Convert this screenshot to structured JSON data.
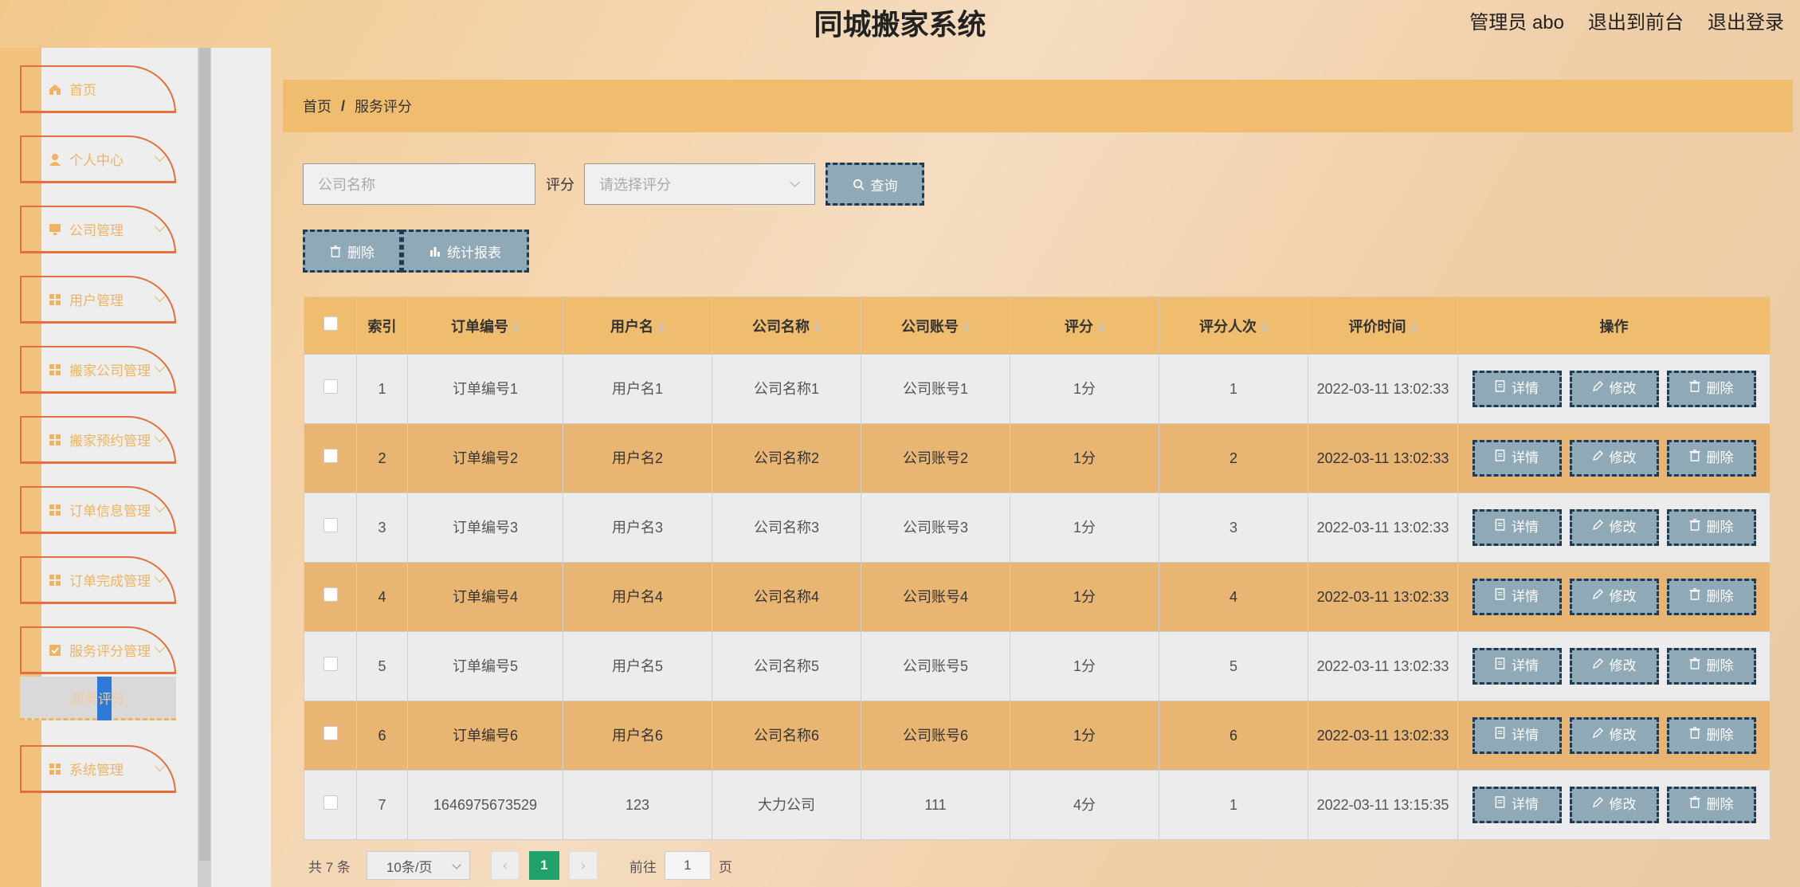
{
  "header": {
    "title": "同城搬家系统",
    "admin": "管理员 abo",
    "back_front": "退出到前台",
    "logout": "退出登录"
  },
  "sidebar": {
    "items": [
      {
        "label": "首页",
        "icon": "home-icon",
        "has_children": false
      },
      {
        "label": "个人中心",
        "icon": "user-icon",
        "has_children": true
      },
      {
        "label": "公司管理",
        "icon": "monitor-icon",
        "has_children": true
      },
      {
        "label": "用户管理",
        "icon": "grid-icon",
        "has_children": true
      },
      {
        "label": "搬家公司管理",
        "icon": "grid-icon",
        "has_children": true
      },
      {
        "label": "搬家预约管理",
        "icon": "grid-icon",
        "has_children": true
      },
      {
        "label": "订单信息管理",
        "icon": "grid-icon",
        "has_children": true
      },
      {
        "label": "订单完成管理",
        "icon": "grid-icon",
        "has_children": true
      },
      {
        "label": "服务评分管理",
        "icon": "checkbox-icon",
        "has_children": true
      },
      {
        "label": "系统管理",
        "icon": "grid-icon",
        "has_children": true
      }
    ],
    "active_sub": "服务评分"
  },
  "breadcrumb": {
    "home": "首页",
    "sep": "/",
    "current": "服务评分"
  },
  "search": {
    "company_placeholder": "公司名称",
    "rating_label": "评分",
    "rating_placeholder": "请选择评分",
    "query_label": "查询"
  },
  "actions": {
    "delete_label": "删除",
    "stats_label": "统计报表"
  },
  "table": {
    "headers": [
      "索引",
      "订单编号",
      "用户名",
      "公司名称",
      "公司账号",
      "评分",
      "评分人次",
      "评价时间",
      "操作"
    ],
    "rows": [
      {
        "index": "1",
        "order": "订单编号1",
        "user": "用户名1",
        "company": "公司名称1",
        "account": "公司账号1",
        "rating": "1分",
        "count": "1",
        "time": "2022-03-11 13:02:33"
      },
      {
        "index": "2",
        "order": "订单编号2",
        "user": "用户名2",
        "company": "公司名称2",
        "account": "公司账号2",
        "rating": "1分",
        "count": "2",
        "time": "2022-03-11 13:02:33"
      },
      {
        "index": "3",
        "order": "订单编号3",
        "user": "用户名3",
        "company": "公司名称3",
        "account": "公司账号3",
        "rating": "1分",
        "count": "3",
        "time": "2022-03-11 13:02:33"
      },
      {
        "index": "4",
        "order": "订单编号4",
        "user": "用户名4",
        "company": "公司名称4",
        "account": "公司账号4",
        "rating": "1分",
        "count": "4",
        "time": "2022-03-11 13:02:33"
      },
      {
        "index": "5",
        "order": "订单编号5",
        "user": "用户名5",
        "company": "公司名称5",
        "account": "公司账号5",
        "rating": "1分",
        "count": "5",
        "time": "2022-03-11 13:02:33"
      },
      {
        "index": "6",
        "order": "订单编号6",
        "user": "用户名6",
        "company": "公司名称6",
        "account": "公司账号6",
        "rating": "1分",
        "count": "6",
        "time": "2022-03-11 13:02:33"
      },
      {
        "index": "7",
        "order": "1646975673529",
        "user": "123",
        "company": "大力公司",
        "account": "111",
        "rating": "4分",
        "count": "1",
        "time": "2022-03-11 13:15:35"
      }
    ],
    "op_labels": {
      "detail": "详情",
      "edit": "修改",
      "delete": "删除"
    }
  },
  "pagination": {
    "total": "共 7 条",
    "page_size": "10条/页",
    "prev": "‹",
    "current": "1",
    "next": "›",
    "goto_prefix": "前往",
    "goto_value": "1",
    "goto_suffix": "页"
  },
  "colors": {
    "accent": "#f0bd6e",
    "button": "#8fa9b6",
    "pager_active": "#1fa36a"
  }
}
